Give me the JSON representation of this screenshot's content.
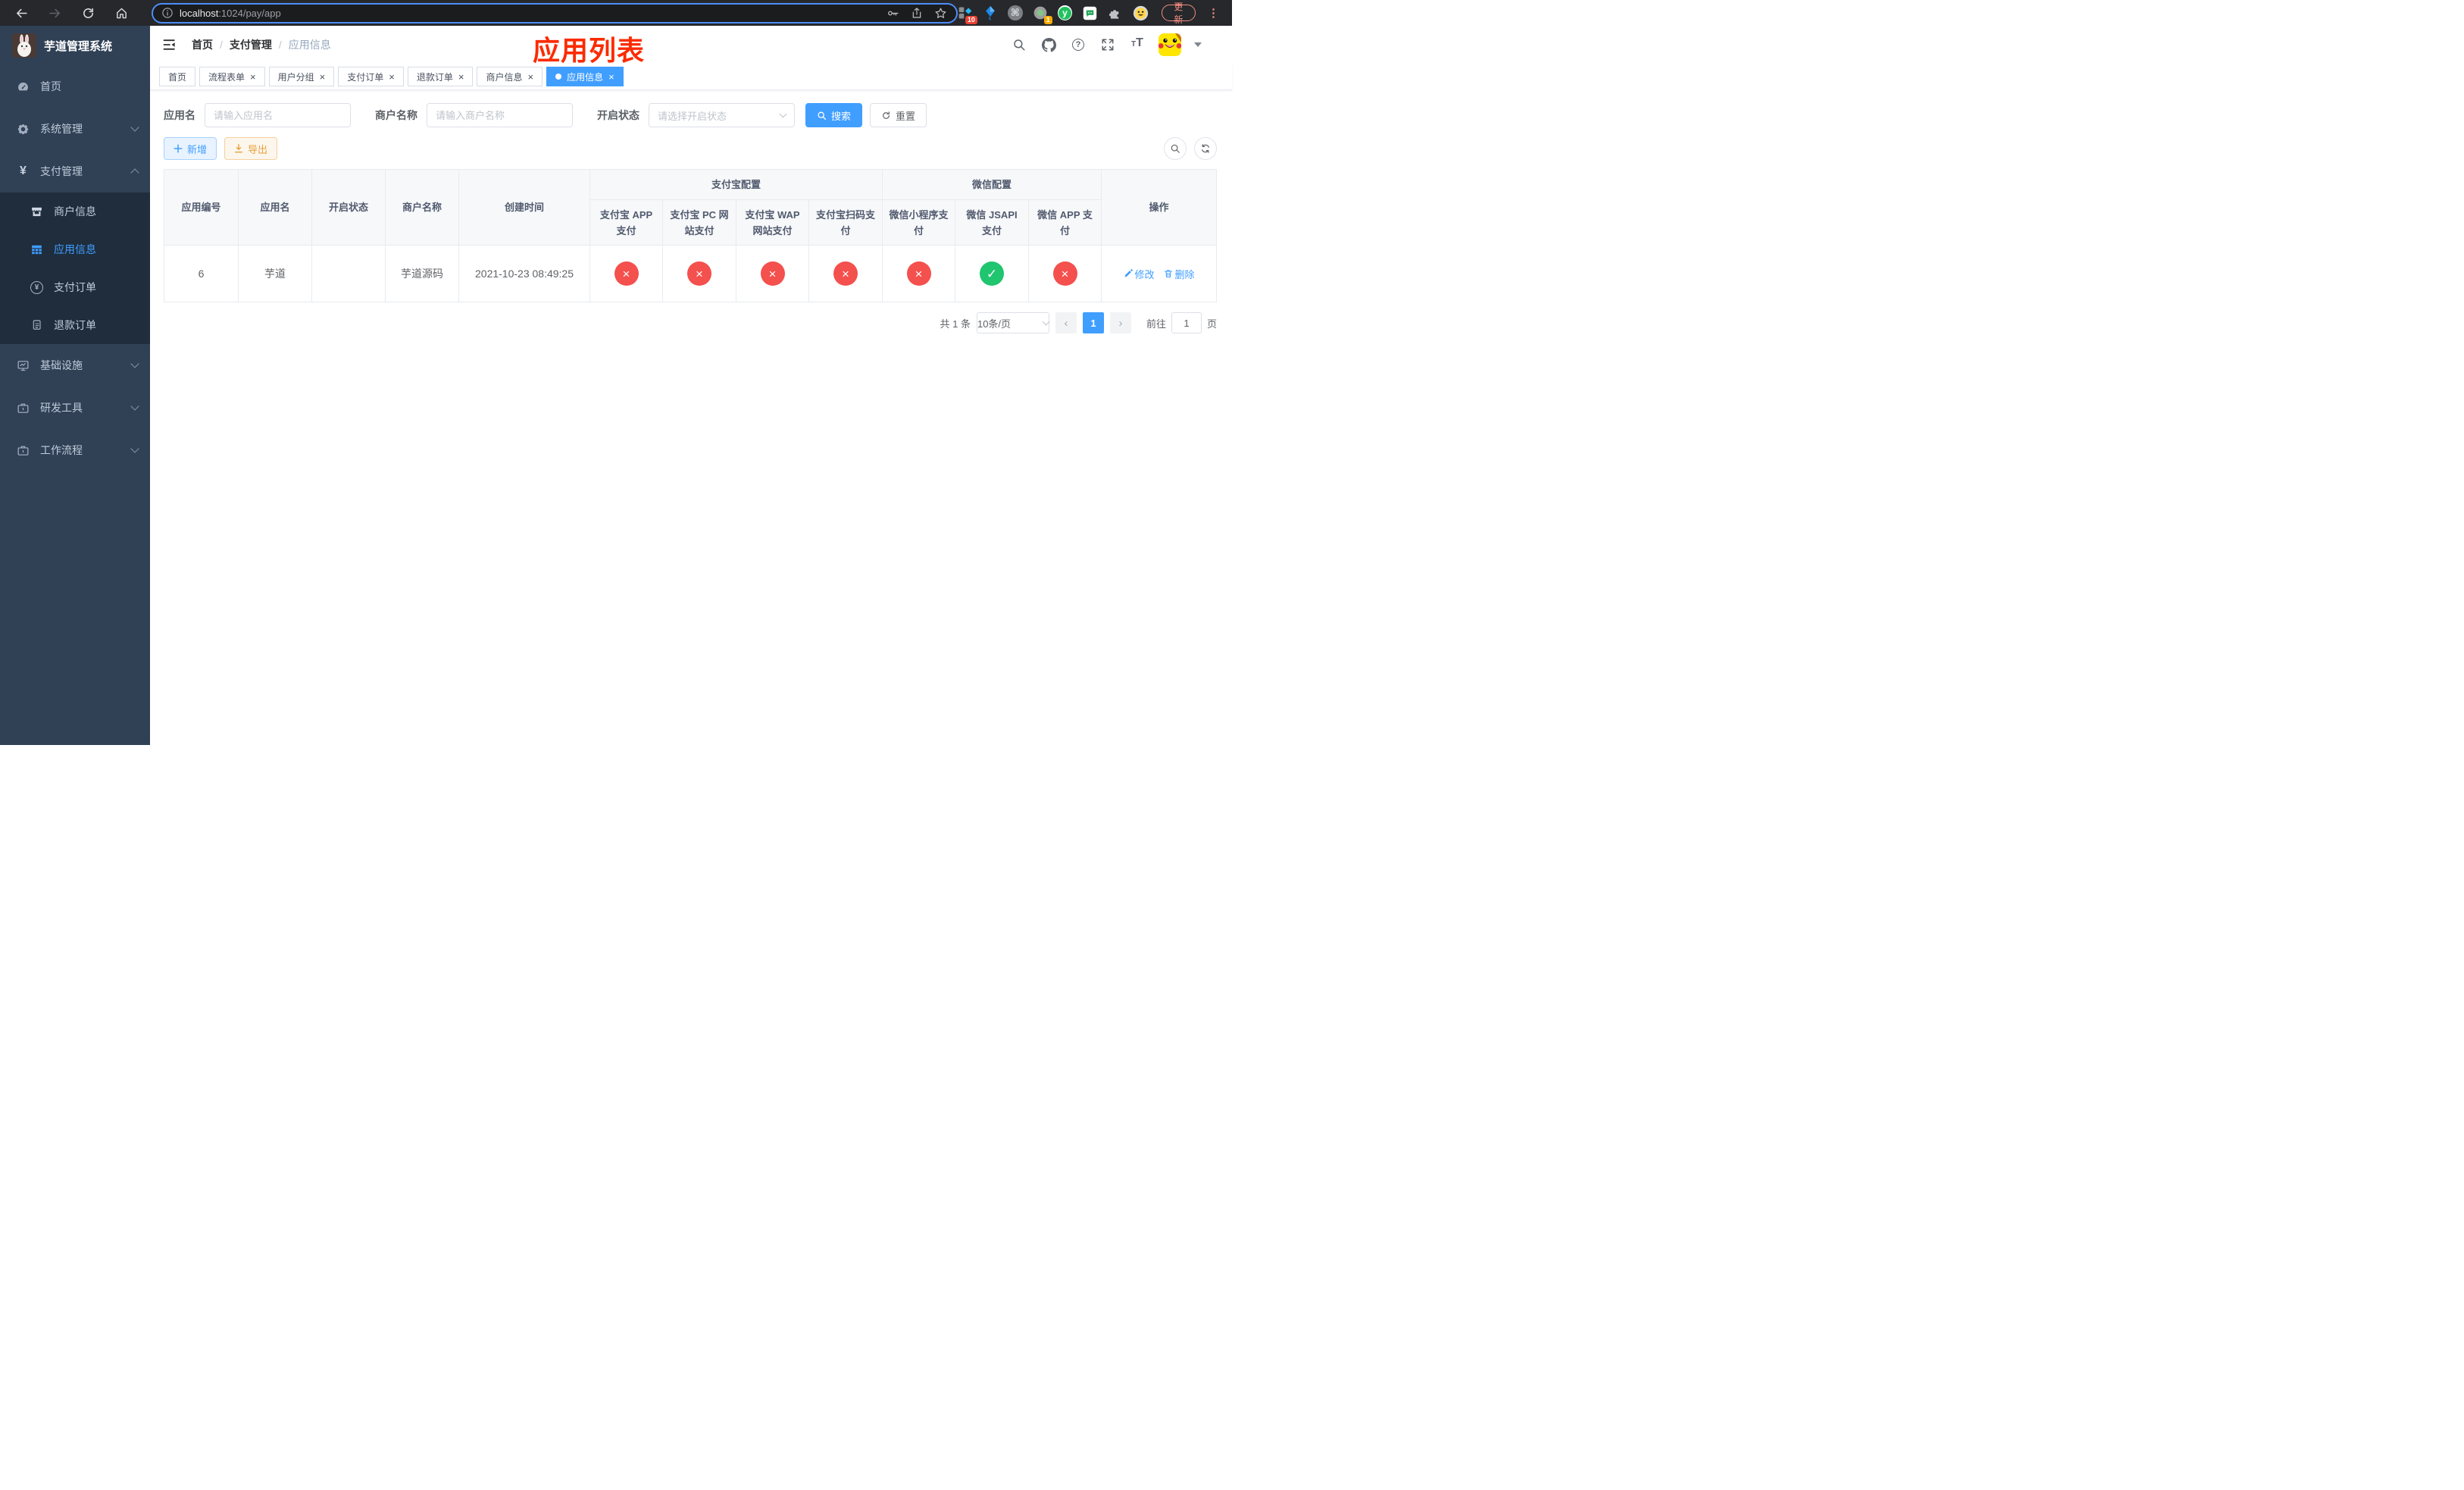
{
  "colors": {
    "accent": "#409eff",
    "danger": "#f4504d",
    "success": "#20c56f",
    "warning": "#e6a23c",
    "annotation": "#fb2b01",
    "sidebar-bg": "#304156",
    "submenu-bg": "#1f2d3d",
    "chrome-red": "#f28b82"
  },
  "browser": {
    "url_host": "localhost",
    "url_path": ":1024/pay/app",
    "update_label": "更新",
    "ext_badges": {
      "first": "10",
      "fourth": "1"
    },
    "icons": {
      "cmd": "⌘",
      "y": "y",
      "kebab": "⋮"
    }
  },
  "sidebar": {
    "title": "芋道管理系统",
    "icons": {
      "yen": "¥"
    },
    "menu": [
      {
        "label": "首页"
      },
      {
        "label": "系统管理"
      },
      {
        "label": "支付管理"
      },
      {
        "label": "商户信息"
      },
      {
        "label": "应用信息"
      },
      {
        "label": "支付订单"
      },
      {
        "label": "退款订单"
      },
      {
        "label": "基础设施"
      },
      {
        "label": "研发工具"
      },
      {
        "label": "工作流程"
      }
    ]
  },
  "header": {
    "breadcrumb": {
      "items": [
        {
          "label": "首页"
        },
        {
          "label": "支付管理"
        },
        {
          "label": "应用信息"
        }
      ],
      "separator": "/"
    },
    "annotation": "应用列表",
    "icons": {
      "help": "?",
      "font_small": "T",
      "font_large": "T"
    }
  },
  "tabs": [
    {
      "label": "首页"
    },
    {
      "label": "流程表单",
      "close": "×"
    },
    {
      "label": "用户分组",
      "close": "×"
    },
    {
      "label": "支付订单",
      "close": "×"
    },
    {
      "label": "退款订单",
      "close": "×"
    },
    {
      "label": "商户信息",
      "close": "×"
    },
    {
      "label": "应用信息",
      "close": "×"
    }
  ],
  "filters": {
    "app_name": {
      "label": "应用名",
      "placeholder": "请输入应用名"
    },
    "merchant_name": {
      "label": "商户名称",
      "placeholder": "请输入商户名称"
    },
    "status": {
      "label": "开启状态",
      "placeholder": "请选择开启状态"
    },
    "search_label": "搜索",
    "reset_label": "重置"
  },
  "toolbar": {
    "add_label": "新增",
    "export_label": "导出"
  },
  "table": {
    "groups": {
      "alipay": "支付宝配置",
      "wechat": "微信配置"
    },
    "columns": {
      "id": "应用编号",
      "name": "应用名",
      "status": "开启状态",
      "merchant": "商户名称",
      "created": "创建时间",
      "alipay_app": "支付宝 APP 支付",
      "alipay_pc": "支付宝 PC 网站支付",
      "alipay_wap": "支付宝 WAP 网站支付",
      "alipay_qr": "支付宝扫码支付",
      "wx_mini": "微信小程序支付",
      "wx_jsapi": "微信 JSAPI 支付",
      "wx_app": "微信 APP 支付",
      "actions": "操作"
    },
    "rows": [
      {
        "id": "6",
        "name": "芋道",
        "enabled": "on",
        "merchant": "芋道源码",
        "created": "2021-10-23 08:49:25",
        "configs": {
          "alipay_app": {
            "state": "off",
            "glyph": "×"
          },
          "alipay_pc": {
            "state": "off",
            "glyph": "×"
          },
          "alipay_wap": {
            "state": "off",
            "glyph": "×"
          },
          "alipay_qr": {
            "state": "off",
            "glyph": "×"
          },
          "wx_mini": {
            "state": "off",
            "glyph": "×"
          },
          "wx_jsapi": {
            "state": "on",
            "glyph": "✓"
          },
          "wx_app": {
            "state": "off",
            "glyph": "×"
          }
        },
        "edit_label": "修改",
        "delete_label": "删除"
      }
    ]
  },
  "pagination": {
    "total": "共 1 条",
    "page_size": "10条/页",
    "prev": "‹",
    "page": "1",
    "next": "›",
    "goto_label": "前往",
    "goto_value": "1",
    "page_unit": "页"
  }
}
